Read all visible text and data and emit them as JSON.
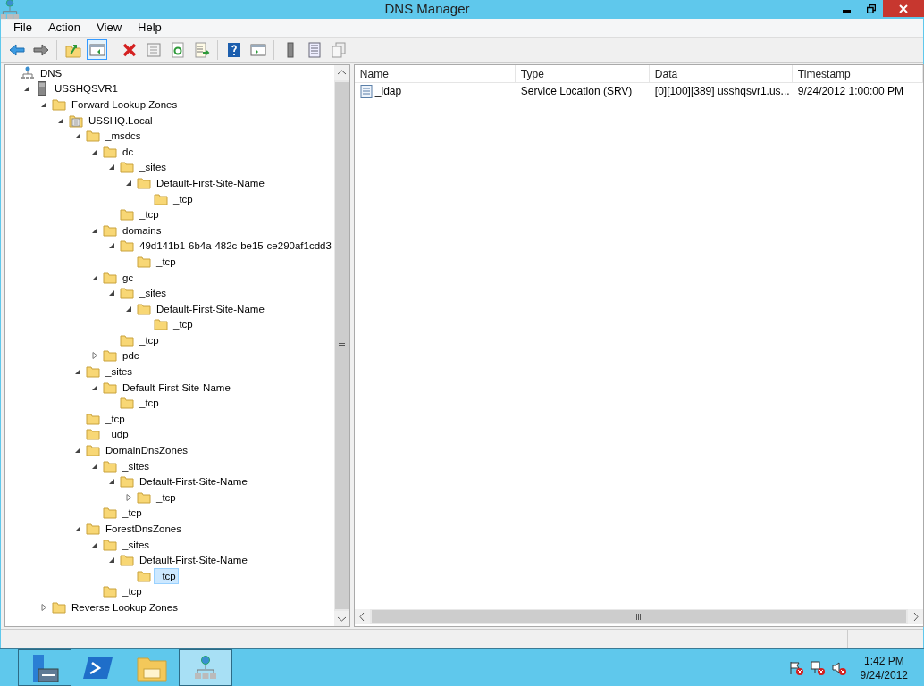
{
  "window": {
    "title": "DNS Manager"
  },
  "menu": [
    "File",
    "Action",
    "View",
    "Help"
  ],
  "toolbar": [
    {
      "kind": "back"
    },
    {
      "kind": "forward"
    },
    {
      "kind": "sep"
    },
    {
      "kind": "up",
      "selected": false
    },
    {
      "kind": "tree",
      "selected": true
    },
    {
      "kind": "sep"
    },
    {
      "kind": "delete"
    },
    {
      "kind": "properties"
    },
    {
      "kind": "refresh"
    },
    {
      "kind": "export"
    },
    {
      "kind": "sep"
    },
    {
      "kind": "help"
    },
    {
      "kind": "actionpane"
    },
    {
      "kind": "sep"
    },
    {
      "kind": "server"
    },
    {
      "kind": "list"
    },
    {
      "kind": "copy"
    }
  ],
  "tree": [
    {
      "label": "DNS",
      "kind": "dns",
      "selected": false,
      "children": [
        {
          "label": "USSHQSVR1",
          "kind": "server",
          "expanded": true,
          "selected": false,
          "children": [
            {
              "label": "Forward Lookup Zones",
              "kind": "folder",
              "expanded": true,
              "selected": false,
              "children": [
                {
                  "label": "USSHQ.Local",
                  "kind": "zone",
                  "expanded": true,
                  "selected": false,
                  "children": [
                    {
                      "label": "_msdcs",
                      "kind": "folder",
                      "expanded": true,
                      "selected": false,
                      "children": [
                        {
                          "label": "dc",
                          "kind": "folder",
                          "expanded": true,
                          "selected": false,
                          "children": [
                            {
                              "label": "_sites",
                              "kind": "folder",
                              "expanded": true,
                              "selected": false,
                              "children": [
                                {
                                  "label": "Default-First-Site-Name",
                                  "kind": "folder",
                                  "expanded": true,
                                  "selected": false,
                                  "children": [
                                    {
                                      "label": "_tcp",
                                      "kind": "folder",
                                      "selected": false
                                    }
                                  ]
                                }
                              ]
                            },
                            {
                              "label": "_tcp",
                              "kind": "folder",
                              "selected": false
                            }
                          ]
                        },
                        {
                          "label": "domains",
                          "kind": "folder",
                          "expanded": true,
                          "selected": false,
                          "children": [
                            {
                              "label": "49d141b1-6b4a-482c-be15-ce290af1cdd3",
                              "kind": "folder",
                              "expanded": true,
                              "selected": false,
                              "children": [
                                {
                                  "label": "_tcp",
                                  "kind": "folder",
                                  "selected": false
                                }
                              ]
                            }
                          ]
                        },
                        {
                          "label": "gc",
                          "kind": "folder",
                          "expanded": true,
                          "selected": false,
                          "children": [
                            {
                              "label": "_sites",
                              "kind": "folder",
                              "expanded": true,
                              "selected": false,
                              "children": [
                                {
                                  "label": "Default-First-Site-Name",
                                  "kind": "folder",
                                  "expanded": true,
                                  "selected": false,
                                  "children": [
                                    {
                                      "label": "_tcp",
                                      "kind": "folder",
                                      "selected": false
                                    }
                                  ]
                                }
                              ]
                            },
                            {
                              "label": "_tcp",
                              "kind": "folder",
                              "selected": false
                            }
                          ]
                        },
                        {
                          "label": "pdc",
                          "kind": "folder",
                          "expanded": false,
                          "selected": false
                        }
                      ]
                    },
                    {
                      "label": "_sites",
                      "kind": "folder",
                      "expanded": true,
                      "selected": false,
                      "children": [
                        {
                          "label": "Default-First-Site-Name",
                          "kind": "folder",
                          "expanded": true,
                          "selected": false,
                          "children": [
                            {
                              "label": "_tcp",
                              "kind": "folder",
                              "selected": false
                            }
                          ]
                        }
                      ]
                    },
                    {
                      "label": "_tcp",
                      "kind": "folder",
                      "selected": false
                    },
                    {
                      "label": "_udp",
                      "kind": "folder",
                      "selected": false
                    },
                    {
                      "label": "DomainDnsZones",
                      "kind": "folder",
                      "expanded": true,
                      "selected": false,
                      "children": [
                        {
                          "label": "_sites",
                          "kind": "folder",
                          "expanded": true,
                          "selected": false,
                          "children": [
                            {
                              "label": "Default-First-Site-Name",
                              "kind": "folder",
                              "expanded": true,
                              "selected": false,
                              "children": [
                                {
                                  "label": "_tcp",
                                  "kind": "folder",
                                  "expanded": false,
                                  "selected": false
                                }
                              ]
                            }
                          ]
                        },
                        {
                          "label": "_tcp",
                          "kind": "folder",
                          "selected": false
                        }
                      ]
                    },
                    {
                      "label": "ForestDnsZones",
                      "kind": "folder",
                      "expanded": true,
                      "selected": false,
                      "children": [
                        {
                          "label": "_sites",
                          "kind": "folder",
                          "expanded": true,
                          "selected": false,
                          "children": [
                            {
                              "label": "Default-First-Site-Name",
                              "kind": "folder",
                              "expanded": true,
                              "selected": false,
                              "children": [
                                {
                                  "label": "_tcp",
                                  "kind": "folder",
                                  "selected": true
                                }
                              ]
                            }
                          ]
                        },
                        {
                          "label": "_tcp",
                          "kind": "folder",
                          "selected": false
                        }
                      ]
                    }
                  ]
                }
              ]
            },
            {
              "label": "Reverse Lookup Zones",
              "kind": "folder",
              "expanded": false,
              "selected": false
            }
          ]
        }
      ]
    }
  ],
  "table": {
    "columns": [
      "Name",
      "Type",
      "Data",
      "Timestamp"
    ],
    "rows": [
      {
        "cells": [
          "_ldap",
          "Service Location (SRV)",
          "[0][100][389] usshqsvr1.us...",
          "9/24/2012 1:00:00 PM"
        ],
        "selected": false
      }
    ]
  },
  "taskbar": {
    "apps": [
      {
        "kind": "server-manager",
        "selected": false
      },
      {
        "kind": "powershell",
        "selected": false
      },
      {
        "kind": "explorer",
        "selected": false
      },
      {
        "kind": "dns",
        "selected": true
      }
    ],
    "tray": [
      {
        "kind": "flag"
      },
      {
        "kind": "network"
      },
      {
        "kind": "speaker"
      }
    ],
    "time": "1:42 PM",
    "date": "9/24/2012"
  }
}
